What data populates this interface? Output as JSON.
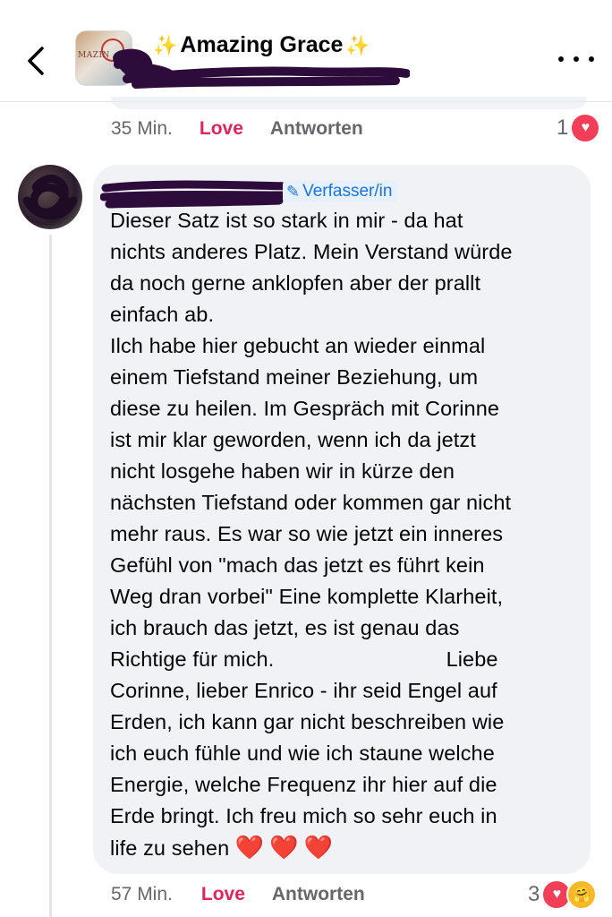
{
  "header": {
    "title": "Amazing Grace",
    "sparkle_left": "✨",
    "sparkle_right": "✨",
    "back_icon": "chevron-left-icon",
    "more_icon": "more-horizontal-icon",
    "avatar_text": "MAZIN"
  },
  "previous_comment": {
    "time": "35 Min.",
    "love_label": "Love",
    "reply_label": "Antworten",
    "reaction_count": "1",
    "reactions": [
      "love"
    ]
  },
  "comment": {
    "author_badge": "Verfasser/in",
    "text": "Dieser Satz ist so stark in mir - da hat\nnichts anderes Platz. Mein Verstand würde\nda noch gerne anklopfen aber der prallt\neinfach ab.\nIlch habe hier gebucht an wieder einmal\neinem Tiefstand meiner Beziehung, um\ndiese zu heilen. Im Gespräch mit Corinne\nist mir klar geworden, wenn ich da jetzt\nnicht losgehe haben wir in kürze den\nnächsten Tiefstand oder kommen gar nicht\nmehr raus. Es war so wie jetzt ein inneres\nGefühl von \"mach das jetzt es führt kein\nWeg dran vorbei\" Eine komplette Klarheit,\nich brauch das jetzt, es ist genau das\nRichtige für mich.                             Liebe\nCorinne, lieber Enrico - ihr seid Engel auf\nErden, ich kann gar nicht beschreiben wie\nich euch fühle und wie ich staune welche\nEnergie, welche Frequenz ihr hier auf die\nErde bringt. Ich freu mich so sehr euch in\nlife zu sehen ",
    "hearts": "❤️❤️❤️",
    "time": "57 Min.",
    "love_label": "Love",
    "reply_label": "Antworten",
    "reaction_count": "3",
    "reactions": [
      "love",
      "care"
    ]
  },
  "colors": {
    "love": "#e0245e",
    "badge_blue": "#1b74e4",
    "bubble": "#f0f2f5",
    "muted": "#65676b"
  }
}
